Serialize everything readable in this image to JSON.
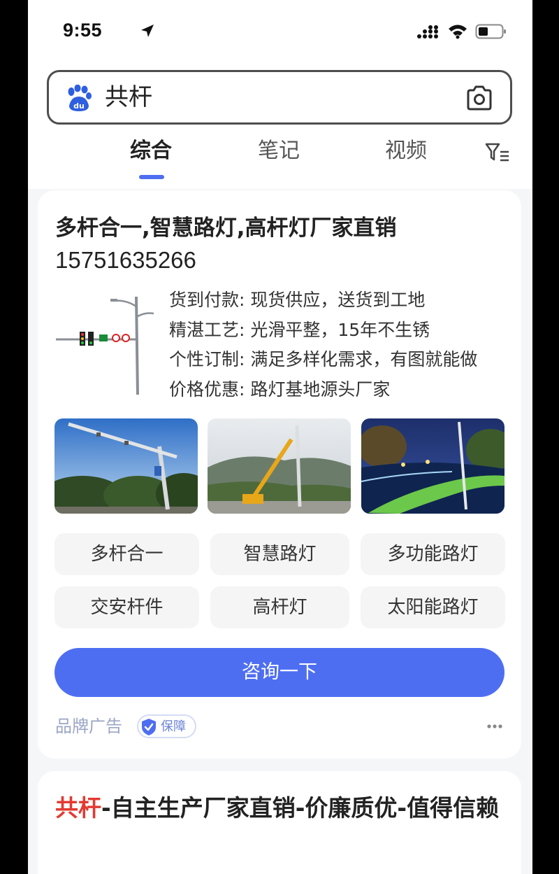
{
  "status_bar": {
    "time": "9:55"
  },
  "search": {
    "query": "共杆"
  },
  "tabs": [
    {
      "label": "综合",
      "active": true
    },
    {
      "label": "笔记",
      "active": false
    },
    {
      "label": "视频",
      "active": false
    }
  ],
  "ad": {
    "title": "多杆合一,智慧路灯,高杆灯厂家直销",
    "phone": "15751635266",
    "features": [
      "货到付款: 现货供应，送货到工地",
      "精湛工艺: 光滑平整，15年不生锈",
      "个性订制: 满足多样化需求，有图就能做",
      "价格优惠: 路灯基地源头厂家"
    ],
    "chips": [
      "多杆合一",
      "智慧路灯",
      "多功能路灯",
      "交安杆件",
      "高杆灯",
      "太阳能路灯"
    ],
    "cta_label": "咨询一下",
    "ad_label": "品牌广告",
    "badge_label": "保障"
  },
  "result": {
    "title_highlight": "共杆",
    "title_rest": "-自主生产厂家直销-价廉质优-值得信赖"
  },
  "colors": {
    "accent": "#4e6ef2",
    "highlight": "#e33a32"
  }
}
